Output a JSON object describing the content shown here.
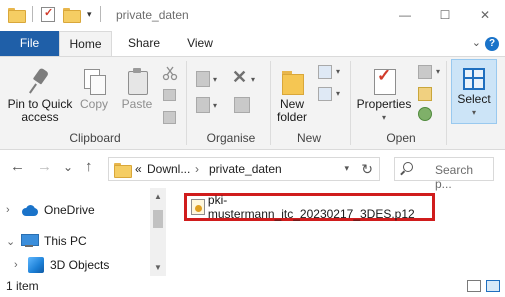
{
  "window": {
    "title": "private_daten",
    "minimize_glyph": "—",
    "maximize_glyph": "☐",
    "close_glyph": "✕"
  },
  "qat": {
    "dropdown_glyph": "▾"
  },
  "tabs": {
    "file": "File",
    "home": "Home",
    "share": "Share",
    "view": "View",
    "expand_glyph": "⌄",
    "help_glyph": "?"
  },
  "ribbon": {
    "clipboard": {
      "pin_label": "Pin to Quick access",
      "copy_label": "Copy",
      "paste_label": "Paste",
      "group_label": "Clipboard"
    },
    "organise": {
      "group_label": "Organise",
      "delete_glyph": "✕"
    },
    "new": {
      "new_folder_label": "New folder",
      "group_label": "New"
    },
    "open": {
      "properties_label": "Properties",
      "group_label": "Open"
    },
    "select": {
      "select_label": "Select"
    }
  },
  "navigation": {
    "back_glyph": "←",
    "forward_glyph": "→",
    "recent_glyph": "⌄",
    "up_glyph": "↑",
    "address_prefix": "«",
    "breadcrumb": [
      "Downl...",
      "private_daten"
    ],
    "crumb_sep": "›",
    "refresh_glyph": "↻",
    "search_placeholder": "Search p..."
  },
  "tree": [
    {
      "label": "OneDrive",
      "icon": "cloud-icon",
      "expander": "›"
    },
    {
      "label": "This PC",
      "icon": "pc-icon",
      "expander": "⌄"
    },
    {
      "label": "3D Objects",
      "icon": "3d-objects-icon",
      "expander": "›"
    }
  ],
  "files": [
    {
      "name": "pki-mustermann_itc_20230217_3DES.p12",
      "icon": "certificate-icon"
    }
  ],
  "status": {
    "item_count": "1 item"
  },
  "colors": {
    "accent": "#1f5fa8",
    "highlight": "#d01c1c",
    "select_bg": "#cce4f7"
  }
}
